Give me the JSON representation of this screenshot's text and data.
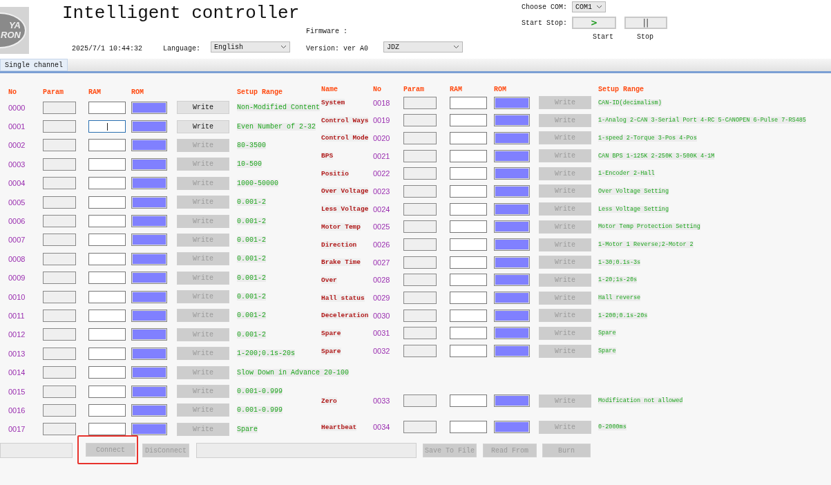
{
  "logo": {
    "lines": [
      "YA",
      "RON"
    ]
  },
  "title": "Intelligent controller",
  "datetime": "2025/7/1 10:44:32",
  "language": {
    "label": "Language:",
    "value": "English"
  },
  "firmware": {
    "label": "Firmware :",
    "version": "Version: ver A0"
  },
  "model_select": {
    "value": "JDZ"
  },
  "com": {
    "label": "Choose COM:",
    "value": "COM1"
  },
  "start_stop": {
    "label": "Start Stop:",
    "start_symbol": ">",
    "stop_symbol": "||",
    "start_label": "Start",
    "stop_label": "Stop"
  },
  "tabs": [
    {
      "label": "Single channel",
      "selected": true
    }
  ],
  "left_table": {
    "headers": [
      "No",
      "Param",
      "RAM",
      "ROM",
      "Setup Range"
    ],
    "rows": [
      {
        "no": "0000",
        "range": "Non-Modified Content",
        "write": "Write",
        "write_enabled": true,
        "ram_focused": false
      },
      {
        "no": "0001",
        "range": "Even Number of 2-32",
        "write": "Write",
        "write_enabled": true,
        "ram_focused": true
      },
      {
        "no": "0002",
        "range": "80-3500",
        "write": "Write",
        "write_enabled": false,
        "ram_focused": false
      },
      {
        "no": "0003",
        "range": "10-500",
        "write": "Write",
        "write_enabled": false,
        "ram_focused": false
      },
      {
        "no": "0004",
        "range": "1000-50000",
        "write": "Write",
        "write_enabled": false,
        "ram_focused": false
      },
      {
        "no": "0005",
        "range": "0.001-2",
        "write": "Write",
        "write_enabled": false,
        "ram_focused": false
      },
      {
        "no": "0006",
        "range": "0.001-2",
        "write": "Write",
        "write_enabled": false,
        "ram_focused": false
      },
      {
        "no": "0007",
        "range": "0.001-2",
        "write": "Write",
        "write_enabled": false,
        "ram_focused": false
      },
      {
        "no": "0008",
        "range": "0.001-2",
        "write": "Write",
        "write_enabled": false,
        "ram_focused": false
      },
      {
        "no": "0009",
        "range": "0.001-2",
        "write": "Write",
        "write_enabled": false,
        "ram_focused": false
      },
      {
        "no": "0010",
        "range": "0.001-2",
        "write": "Write",
        "write_enabled": false,
        "ram_focused": false
      },
      {
        "no": "0011",
        "range": "0.001-2",
        "write": "Write",
        "write_enabled": false,
        "ram_focused": false
      },
      {
        "no": "0012",
        "range": "0.001-2",
        "write": "Write",
        "write_enabled": false,
        "ram_focused": false
      },
      {
        "no": "0013",
        "range": "1-200;0.1s-20s",
        "write": "Write",
        "write_enabled": false,
        "ram_focused": false
      },
      {
        "no": "0014",
        "range": "Slow Down in Advance 20-100",
        "write": "Write",
        "write_enabled": false,
        "ram_focused": false
      },
      {
        "no": "0015",
        "range": "0.001-0.999",
        "write": "Write",
        "write_enabled": false,
        "ram_focused": false
      },
      {
        "no": "0016",
        "range": "0.001-0.999",
        "write": "Write",
        "write_enabled": false,
        "ram_focused": false
      },
      {
        "no": "0017",
        "range": "Spare",
        "write": "Write",
        "write_enabled": false,
        "ram_focused": false
      }
    ]
  },
  "right_table": {
    "headers": [
      "Name",
      "No",
      "Param",
      "RAM",
      "ROM",
      "Setup Range"
    ],
    "row_groups": [
      [
        {
          "name": "System",
          "no": "0018",
          "range": "CAN-ID(decimalism)",
          "write": "Write",
          "write_enabled": false
        },
        {
          "name": "Control Ways",
          "no": "0019",
          "range": "1-Analog 2-CAN 3-Serial Port 4-RC 5-CANOPEN 6-Pulse 7-RS485",
          "write": "Write",
          "write_enabled": false
        },
        {
          "name": "Control Mode",
          "no": "0020",
          "range": "1-speed 2-Torque 3-Pos 4-Pos",
          "write": "Write",
          "write_enabled": false
        },
        {
          "name": "BPS",
          "no": "0021",
          "range": "CAN BPS 1-125K 2-250K 3-500K 4-1M",
          "write": "Write",
          "write_enabled": false
        },
        {
          "name": "Positio",
          "no": "0022",
          "range": "1-Encoder 2-Hall",
          "write": "Write",
          "write_enabled": false
        },
        {
          "name": "Over Voltage",
          "no": "0023",
          "range": "Over Voltage Setting",
          "write": "Write",
          "write_enabled": false
        },
        {
          "name": "Less Voltage",
          "no": "0024",
          "range": "Less Voltage Setting",
          "write": "Write",
          "write_enabled": false
        },
        {
          "name": "Motor Temp",
          "no": "0025",
          "range": "Motor Temp Protection Setting",
          "write": "Write",
          "write_enabled": false
        },
        {
          "name": "Direction",
          "no": "0026",
          "range": "1-Motor 1 Reverse;2-Motor 2",
          "write": "Write",
          "write_enabled": false
        },
        {
          "name": "Brake Time",
          "no": "0027",
          "range": "1-30;0.1s-3s",
          "write": "Write",
          "write_enabled": false
        },
        {
          "name": "Over",
          "no": "0028",
          "range": "1-20;1s-20s",
          "write": "Write",
          "write_enabled": false
        },
        {
          "name": "Hall status",
          "no": "0029",
          "range": "Hall reverse",
          "write": "Write",
          "write_enabled": false
        },
        {
          "name": "Deceleration",
          "no": "0030",
          "range": "1-200;0.1s-20s",
          "write": "Write",
          "write_enabled": false
        },
        {
          "name": "Spare",
          "no": "0031",
          "range": "Spare",
          "write": "Write",
          "write_enabled": false
        },
        {
          "name": "Spare",
          "no": "0032",
          "range": "Spare",
          "write": "Write",
          "write_enabled": false
        }
      ],
      [
        {
          "name": "Zero",
          "no": "0033",
          "range": "Modification not allowed",
          "write": "Write",
          "write_enabled": false
        },
        {
          "name": "Heartbeat",
          "no": "0034",
          "range": "0-2000ms",
          "write": "Write",
          "write_enabled": false
        }
      ]
    ]
  },
  "bottom_bar": {
    "buttons": [
      {
        "kind": "button",
        "label": "Connect",
        "enabled": false,
        "highlighted": true
      },
      {
        "kind": "button",
        "label": "DisConnect",
        "enabled": false,
        "highlighted": false
      },
      {
        "kind": "field"
      },
      {
        "kind": "button",
        "label": "Save To File",
        "enabled": false,
        "highlighted": false
      },
      {
        "kind": "button",
        "label": "Read From",
        "enabled": false,
        "highlighted": false
      },
      {
        "kind": "button",
        "label": "Burn",
        "enabled": false,
        "highlighted": false
      }
    ]
  }
}
